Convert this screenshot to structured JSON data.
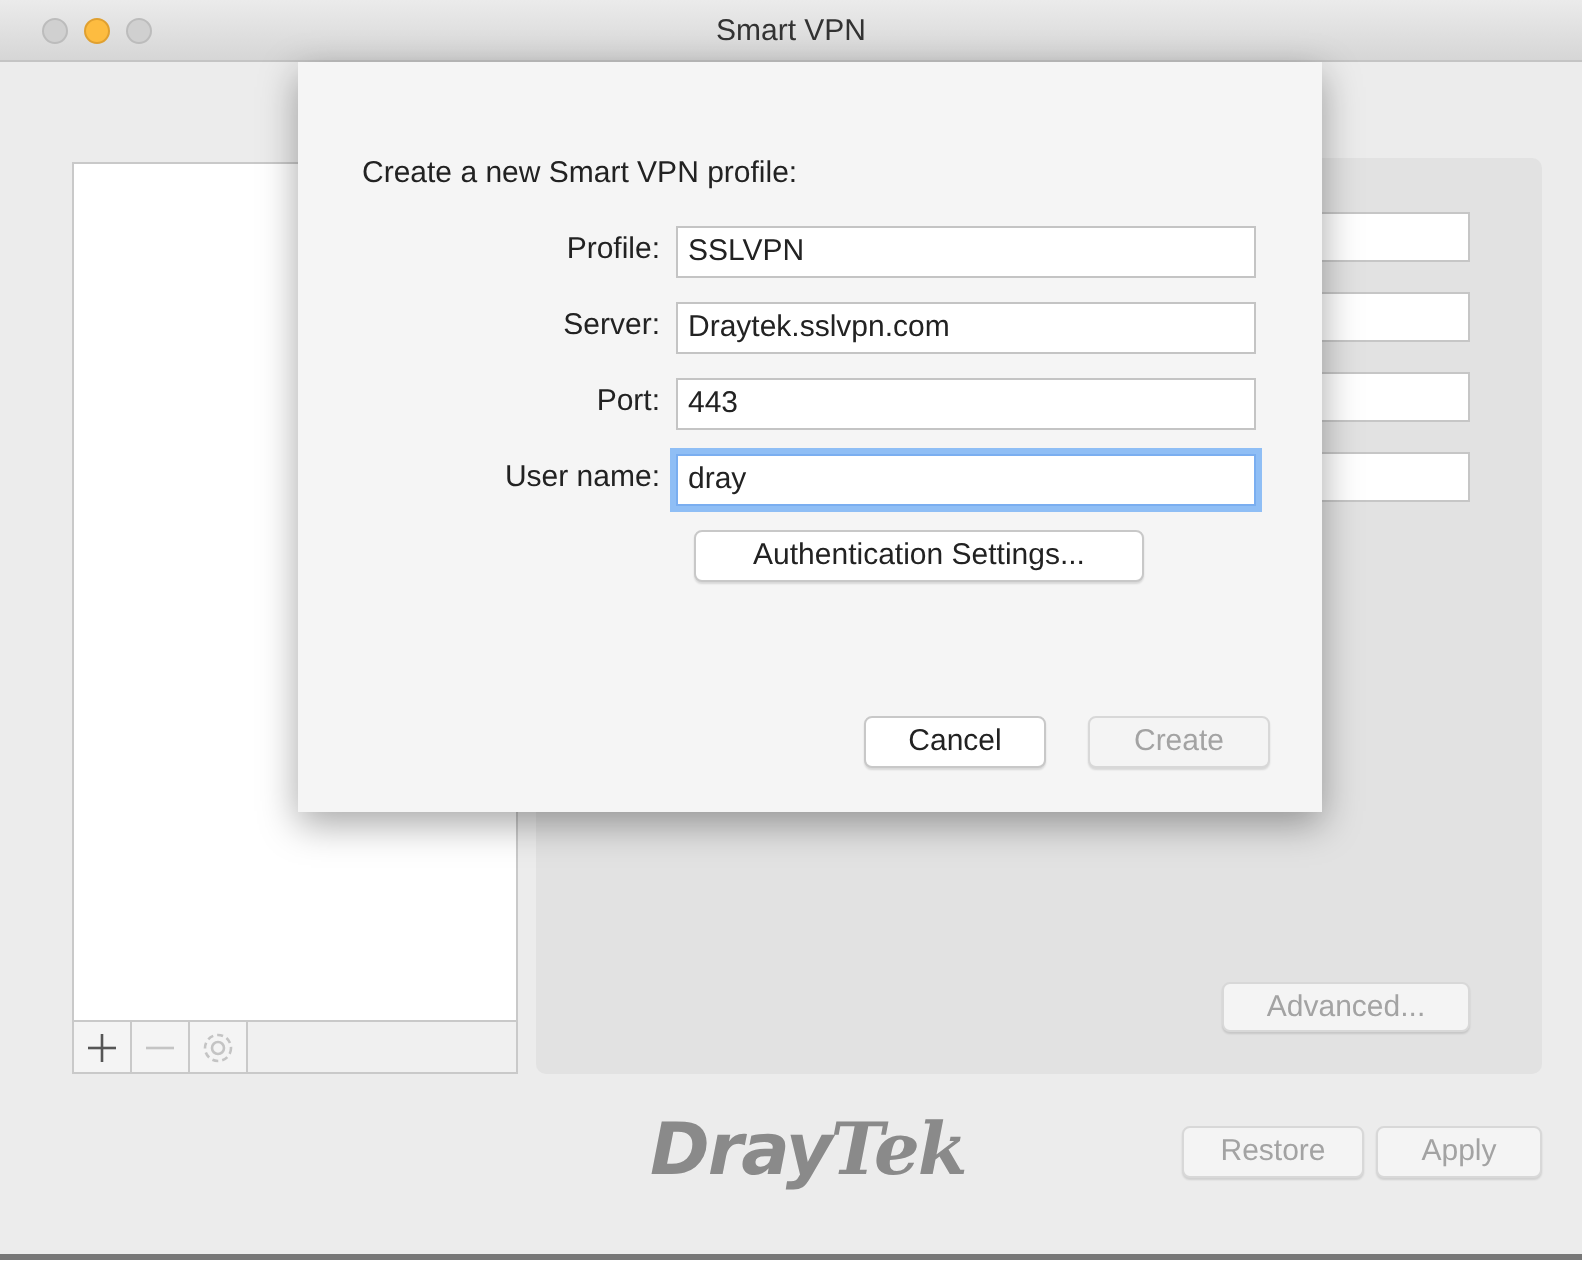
{
  "window": {
    "title": "Smart VPN"
  },
  "sidebar_toolbar": [
    {
      "kind": "add",
      "disabled": false
    },
    {
      "kind": "remove",
      "disabled": true
    },
    {
      "kind": "settings",
      "disabled": true
    }
  ],
  "advanced_button": {
    "label": "Advanced...",
    "disabled": true
  },
  "logo": "**Dray**Tek",
  "footer_buttons": [
    {
      "label": "Restore",
      "disabled": true
    },
    {
      "label": "Apply",
      "disabled": true
    }
  ],
  "sheet": {
    "heading": "Create a new Smart VPN profile:",
    "fields": [
      {
        "label": "Profile:",
        "value": "SSLVPN",
        "focused": false
      },
      {
        "label": "Server:",
        "value": "Draytek.sslvpn.com",
        "focused": false
      },
      {
        "label": "Port:",
        "value": "443",
        "focused": false
      },
      {
        "label": "User name:",
        "value": "dray",
        "focused": true
      }
    ],
    "auth_button": {
      "label": "Authentication Settings..."
    },
    "buttons": [
      {
        "label": "Cancel",
        "disabled": false
      },
      {
        "label": "Create",
        "disabled": true
      }
    ]
  }
}
